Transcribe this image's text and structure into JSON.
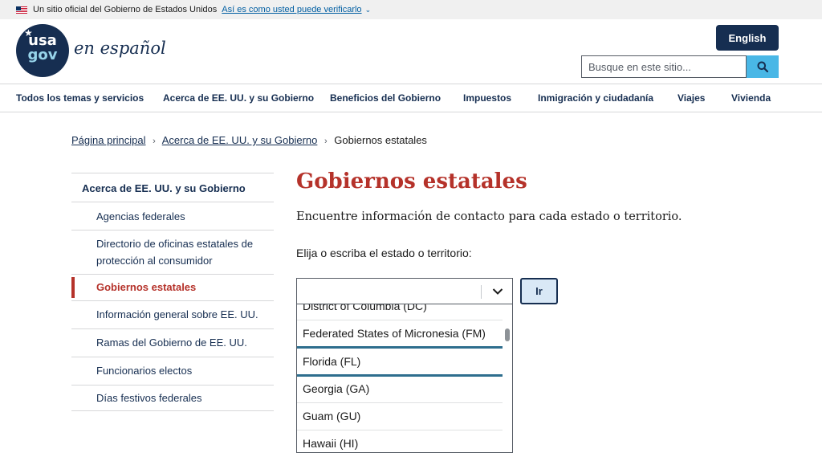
{
  "gov_banner": {
    "text": "Un sitio oficial del Gobierno de Estados Unidos",
    "link": "Así es como usted puede verificarlo"
  },
  "header": {
    "logo_line1": "usa",
    "logo_line2": "gov",
    "logo_text": "en español",
    "english_button": "English",
    "search_placeholder": "Busque en este sitio..."
  },
  "nav": {
    "items": [
      "Todos los temas y servicios",
      "Acerca de EE. UU. y su Gobierno",
      "Beneficios del Gobierno",
      "Impuestos",
      "Inmigración y ciudadanía",
      "Viajes",
      "Vivienda"
    ]
  },
  "breadcrumb": {
    "items": [
      "Página principal",
      "Acerca de EE. UU. y su Gobierno"
    ],
    "current": "Gobiernos estatales"
  },
  "sidenav": {
    "heading": "Acerca de EE. UU. y su Gobierno",
    "items": [
      "Agencias federales",
      "Directorio de oficinas estatales de",
      "protección al consumidor",
      "Gobiernos estatales",
      "Información general sobre EE. UU.",
      "Ramas del Gobierno de EE. UU.",
      "Funcionarios electos",
      "Días festivos federales"
    ],
    "active": "Gobiernos estatales"
  },
  "main": {
    "title": "Gobiernos estatales",
    "intro": "Encuentre información de contacto para cada estado o territorio.",
    "select_label": "Elija o escriba el estado o territorio:",
    "submit_label": "Ir",
    "combo_value": "",
    "options": [
      "District of Columbia (DC)",
      "Federated States of Micronesia (FM)",
      "Florida (FL)",
      "Georgia (GA)",
      "Guam (GU)",
      "Hawaii (HI)"
    ],
    "focused_option": "Florida (FL)"
  },
  "colors": {
    "brand_navy": "#162e51",
    "title_red": "#b5322a",
    "search_blue": "#49b7e6",
    "focus_teal": "#2e6e8e"
  }
}
